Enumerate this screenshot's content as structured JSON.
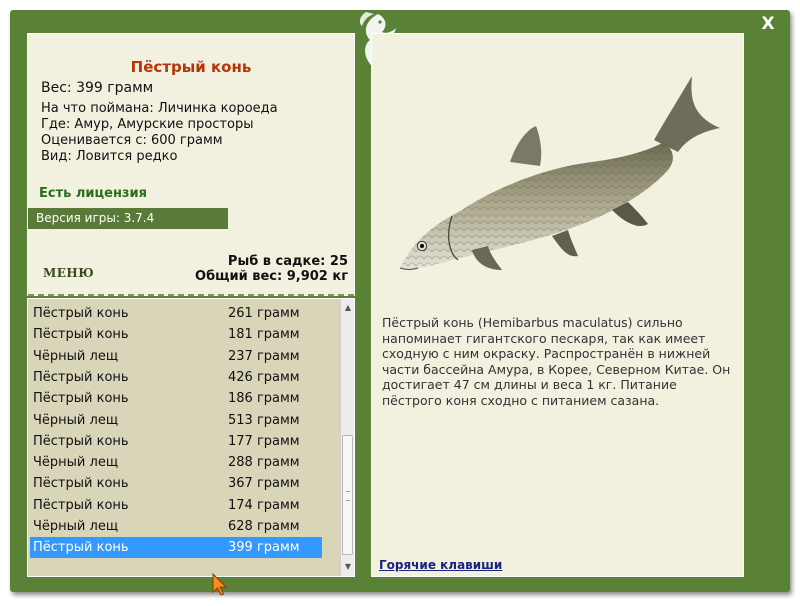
{
  "close_label": "X",
  "fish": {
    "name": "Пёстрый конь",
    "weight": "Вес: 399 грамм",
    "caught_on": "На что поймана: Личинка короеда",
    "location": "Где: Амур, Амурские просторы",
    "valued_from": "Оценивается с: 600 грамм",
    "kind": "Вид: Ловится редко"
  },
  "license": "Есть лицензия",
  "version": "Версия игры: 3.7.4",
  "menu_label": "МЕНЮ",
  "stats": {
    "fish_count": "Рыб в садке: 25",
    "total_weight": "Общий вес: 9,902 кг"
  },
  "catch_list": [
    {
      "name": "Пёстрый конь",
      "weight": "261 грамм"
    },
    {
      "name": "Пёстрый конь",
      "weight": "181 грамм"
    },
    {
      "name": "Чёрный лещ",
      "weight": "237 грамм"
    },
    {
      "name": "Пёстрый конь",
      "weight": "426 грамм"
    },
    {
      "name": "Пёстрый конь",
      "weight": "186 грамм"
    },
    {
      "name": "Чёрный лещ",
      "weight": "513 грамм"
    },
    {
      "name": "Пёстрый конь",
      "weight": "177 грамм"
    },
    {
      "name": "Чёрный лещ",
      "weight": "288 грамм"
    },
    {
      "name": "Пёстрый конь",
      "weight": "367 грамм"
    },
    {
      "name": "Пёстрый конь",
      "weight": "174 грамм"
    },
    {
      "name": "Чёрный лещ",
      "weight": "628 грамм"
    },
    {
      "name": "Пёстрый конь",
      "weight": "399 грамм"
    }
  ],
  "selected_index": 11,
  "description": "Пёстрый конь (Hemibarbus maculatus) сильно напоминает гигантского пескаря, так как имеет сходную с ним окраску. Распространён в нижней части бассейна Амура, в Корее, Северном Китае. Он достигает 47 см длины и веса 1 кг. Питание пёстрого коня сходно с питанием сазана.",
  "hotkeys_label": "Горячие клавиши",
  "colors": {
    "frame": "#5a8236",
    "panel": "#f2f0df",
    "list_bg": "#d8d5b8",
    "title": "#b5350a",
    "license": "#2a6e1c",
    "selection": "#3399ff"
  }
}
